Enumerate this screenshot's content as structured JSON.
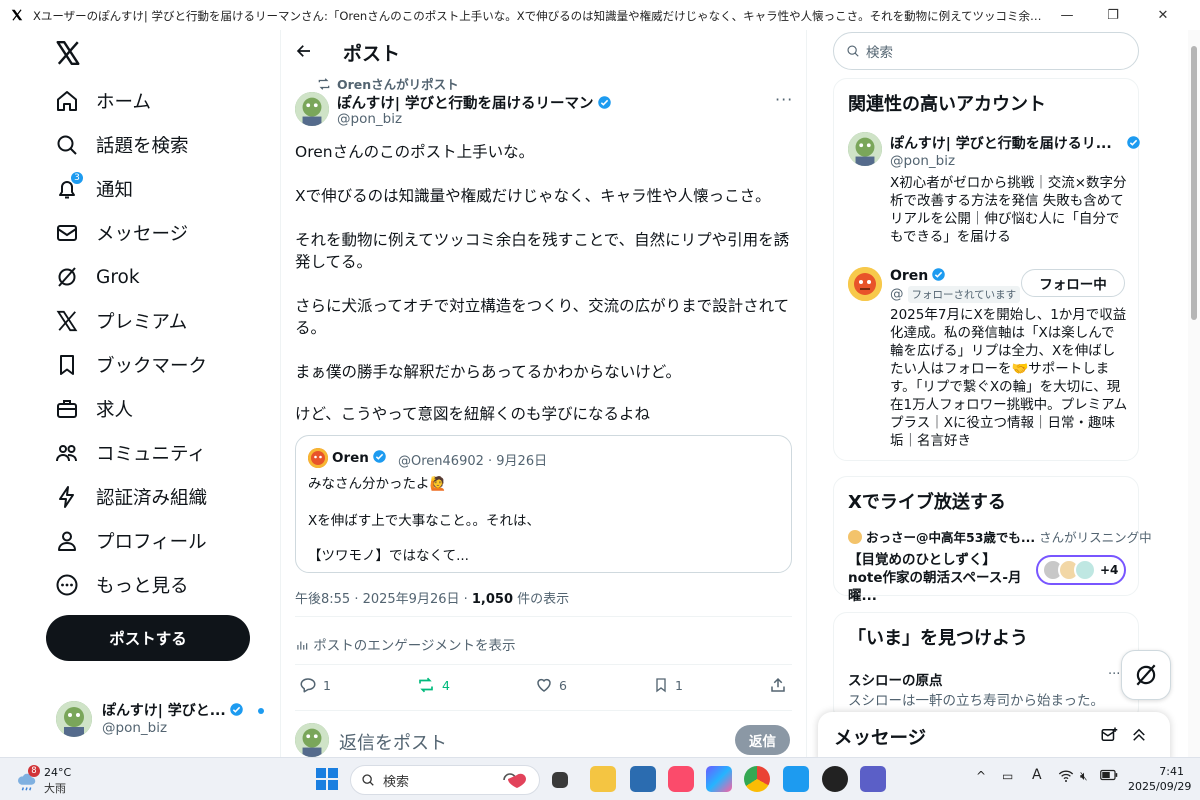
{
  "window": {
    "title": "Xユーザーのぽんすけ| 学びと行動を届けるリーマンさん:「Orenさんのこのポスト上手いな。Xで伸びるのは知識量や権威だけじゃなく、キャラ性や人懐っこさ。それを動物に例えてツッコミ余白を残すことで、自然にリプや引用を誘発してる。さらに犬派っ..."
  },
  "nav": {
    "items": [
      {
        "label": "ホーム",
        "icon": "home-icon"
      },
      {
        "label": "話題を検索",
        "icon": "search-icon"
      },
      {
        "label": "通知",
        "icon": "bell-icon",
        "badge": "3"
      },
      {
        "label": "メッセージ",
        "icon": "mail-icon"
      },
      {
        "label": "Grok",
        "icon": "grok-icon"
      },
      {
        "label": "プレミアム",
        "icon": "x-icon"
      },
      {
        "label": "ブックマーク",
        "icon": "bookmark-icon"
      },
      {
        "label": "求人",
        "icon": "briefcase-icon"
      },
      {
        "label": "コミュニティ",
        "icon": "community-icon"
      },
      {
        "label": "認証済み組織",
        "icon": "lightning-icon"
      },
      {
        "label": "プロフィール",
        "icon": "person-icon"
      },
      {
        "label": "もっと見る",
        "icon": "more-circle-icon"
      }
    ],
    "post_button": "ポストする",
    "account": {
      "name": "ぽんすけ| 学びと...",
      "handle": "@pon_biz"
    }
  },
  "post": {
    "header_title": "ポスト",
    "reposted_by": "Orenさんがリポスト",
    "author_name": "ぽんすけ| 学びと行動を届けるリーマン",
    "author_handle": "@pon_biz",
    "paragraphs": [
      "Orenさんのこのポスト上手いな。",
      "Xで伸びるのは知識量や権威だけじゃなく、キャラ性や人懐っこさ。",
      "それを動物に例えてツッコミ余白を残すことで、自然にリプや引用を誘発してる。",
      "さらに犬派ってオチで対立構造をつくり、交流の広がりまで設計されてる。",
      "まぁ僕の勝手な解釈だからあってるかわからないけど。",
      "けど、こうやって意図を紐解くのも学びになるよね"
    ],
    "quote": {
      "name": "Oren",
      "meta": "@Oren46902 · 9月26日",
      "line1": "みなさん分かったよ🙋",
      "line2": "Xを伸ばす上で大事なこと。。それは、",
      "line3": "【ツワモノ】ではなくて..."
    },
    "timestamp": "午後8:55 · 2025年9月26日 · ",
    "views_count": "1,050",
    "views_label": " 件の表示",
    "engagement_link": "ポストのエンゲージメントを表示",
    "replies": "1",
    "reposts": "4",
    "likes": "6",
    "bookmarks": "1",
    "reply_placeholder": "返信をポスト",
    "reply_button": "返信"
  },
  "sidebar": {
    "search_placeholder": "検索",
    "relevant_title": "関連性の高いアカウント",
    "accounts": [
      {
        "name": "ぽんすけ| 学びと行動を届けるリ...",
        "handle": "@pon_biz",
        "bio": "X初心者がゼロから挑戦｜交流×数字分析で改善する方法を発信 失敗も含めてリアルを公開｜伸び悩む人に「自分でもできる」を届ける"
      },
      {
        "name": "Oren",
        "handle": "@",
        "follows_you": "フォローされています",
        "follow_button": "フォロー中",
        "bio": "2025年7月にXを開始し、1か月で収益化達成。私の発信軸は「Xは楽しんで輪を広げる」リプは全力、Xを伸ばしたい人はフォローを🤝サポートします。「リプで繋ぐXの輪」を大切に、現在1万人フォロワー挑戦中。プレミアムプラス｜Xに役立つ情報｜日常・趣味垢｜名言好き"
      }
    ],
    "live_title": "Xでライブ放送する",
    "live_host": "おっさー@中高年53歳でも...",
    "live_status": "さんがリスニング中",
    "live_space_title": "【目覚めのひとしずく】note作家の朝活スペース-月曜...",
    "live_count": "+4",
    "trends_title": "「いま」を見つけよう",
    "trend_name": "スシローの原点",
    "trend_desc": "スシローは一軒の立ち寿司から始まった。",
    "messages_title": "メッセージ"
  },
  "taskbar": {
    "weather_badge": "8",
    "temperature": "24°C",
    "condition": "大雨",
    "search_label": "検索",
    "time": "7:41",
    "date": "2025/09/29"
  },
  "colors": {
    "accent": "#1d9bf0",
    "repost_green": "#00ba7c",
    "text": "#0f1419",
    "muted": "#536471"
  }
}
